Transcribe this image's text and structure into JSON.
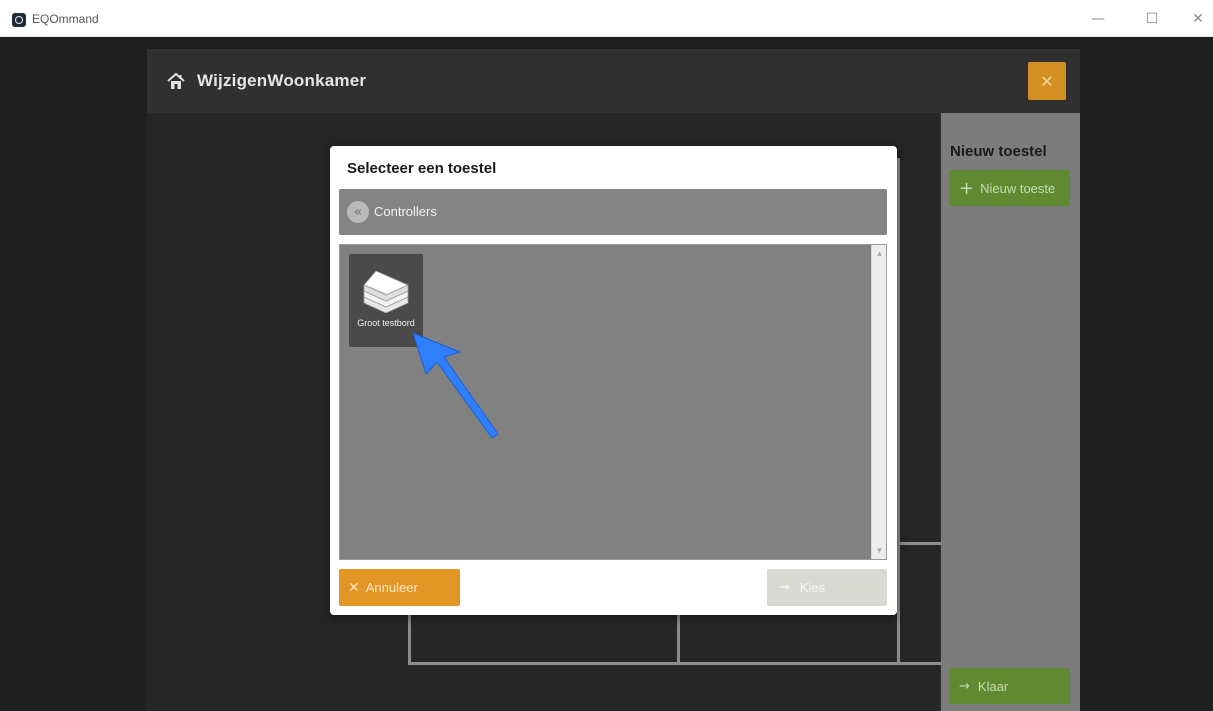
{
  "window": {
    "title": "EQOmmand",
    "minimize_glyph": "—",
    "maximize_glyph": "☐",
    "close_glyph": "✕"
  },
  "editor": {
    "title": "WijzigenWoonkamer",
    "home_icon": "home-icon",
    "close_glyph": "✕",
    "close_color": "#d48f22"
  },
  "side_panel": {
    "title": "Nieuw toestel",
    "add_button": {
      "icon": "+",
      "label": "Nieuw toeste"
    },
    "done_button": {
      "icon": "→",
      "label": "Klaar"
    },
    "button_color": "#5f8a32"
  },
  "modal": {
    "title": "Selecteer een toestel",
    "breadcrumb": {
      "back_icon": "«",
      "label": "Controllers"
    },
    "items": [
      {
        "label": "Groot testbord",
        "icon": "controller-box-icon"
      }
    ],
    "cancel_button": {
      "icon": "✕",
      "label": "Annuleer",
      "color": "#e39626"
    },
    "choose_button": {
      "icon": "→",
      "label": "Kies",
      "disabled": true
    }
  },
  "annotation": {
    "type": "arrow",
    "color": "#2f7fff",
    "points_to": "Groot testbord"
  }
}
